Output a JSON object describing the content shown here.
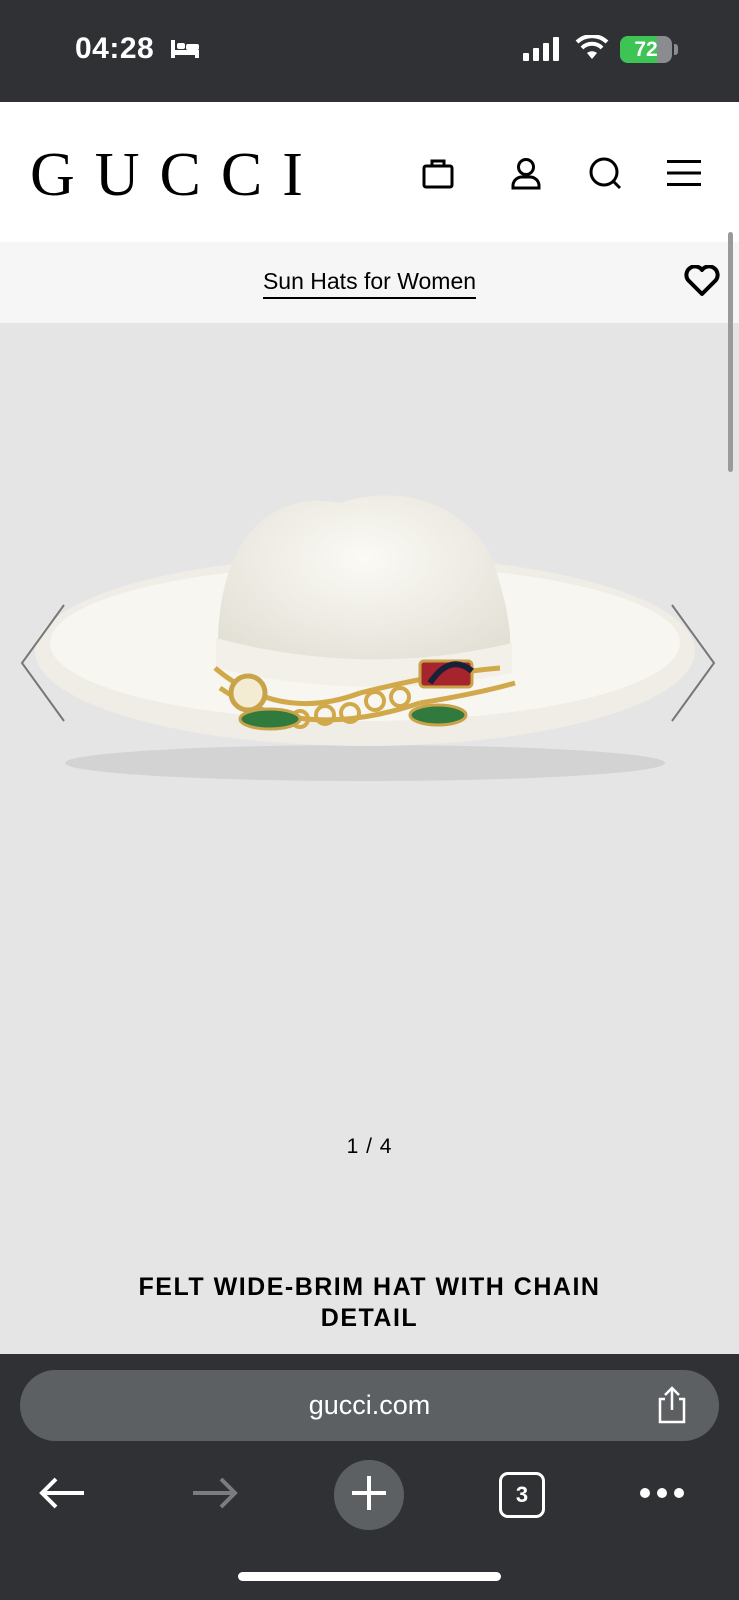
{
  "status_bar": {
    "time": "04:28",
    "battery": "72",
    "battery_level": 0.72
  },
  "header": {
    "logo": "GUCCI",
    "icons": [
      "shopping-bag-icon",
      "account-icon",
      "search-icon",
      "menu-icon"
    ]
  },
  "breadcrumb": {
    "category": "Sun Hats for Women"
  },
  "gallery": {
    "counter": "1 / 4",
    "current": 1,
    "total": 4
  },
  "product": {
    "title": "FELT WIDE-BRIM HAT WITH CHAIN DETAIL"
  },
  "browser": {
    "url": "gucci.com",
    "tab_count": "3"
  },
  "colors": {
    "accent_green": "#3ec355",
    "chrome_dark": "#2f3134",
    "chrome_mid": "#5d6063"
  }
}
